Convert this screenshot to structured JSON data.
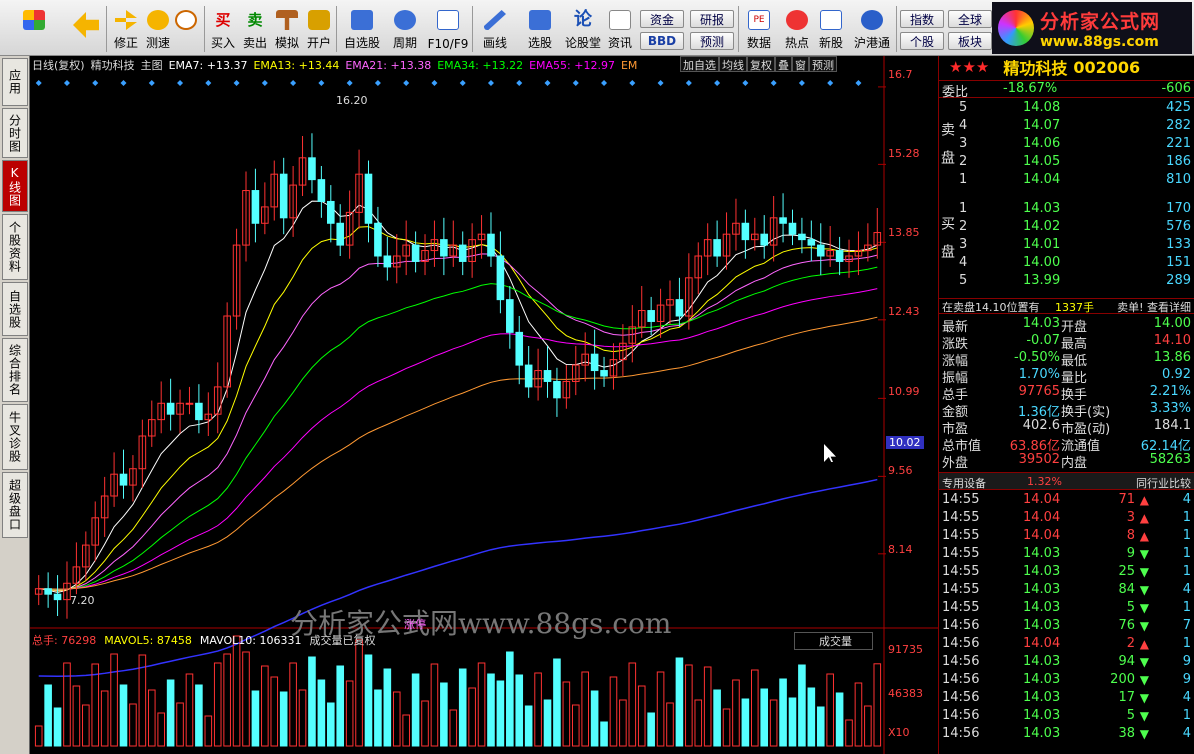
{
  "toolbar": {
    "buttons": [
      {
        "label": "",
        "icon": "app-grid-icon"
      },
      {
        "label": "",
        "icon": "back-arrow-icon"
      },
      {
        "label": "修正",
        "icon": "up-down-icon"
      },
      {
        "label": "测速",
        "icon": "clock-icon"
      },
      {
        "label": "买入",
        "icon": "buy-icon"
      },
      {
        "label": "卖出",
        "icon": "sell-icon"
      },
      {
        "label": "模拟",
        "icon": "hammer-icon"
      },
      {
        "label": "开户",
        "icon": "lock-icon"
      },
      {
        "label": "自选股",
        "icon": "star-icon"
      },
      {
        "label": "周期",
        "icon": "period-icon"
      },
      {
        "label": "F10/F9",
        "icon": "f10-icon"
      },
      {
        "label": "画线",
        "icon": "pen-icon"
      },
      {
        "label": "选股",
        "icon": "select-icon"
      },
      {
        "label": "论股堂",
        "icon": "forum-icon"
      },
      {
        "label": "资讯",
        "icon": "news-icon"
      },
      {
        "label": "数据",
        "icon": "pe-icon"
      },
      {
        "label": "热点",
        "icon": "hot-icon"
      },
      {
        "label": "新股",
        "icon": "newstock-icon"
      },
      {
        "label": "沪港通",
        "icon": "hk-icon"
      }
    ],
    "small_buttons": [
      "资金",
      "BBD",
      "研报",
      "预测",
      "指数",
      "全球",
      "个股",
      "板块"
    ]
  },
  "logo": {
    "title": "分析家公式网",
    "url": "www.88gs.com"
  },
  "side_tabs": [
    "应用",
    "分时图",
    "K线图",
    "个股资料",
    "自选股",
    "综合排名",
    "牛叉诊股",
    "超级盘口"
  ],
  "chart_header": {
    "left": "日线(复权)",
    "stock": "精功科技",
    "main": "主图",
    "ema7": "EMA7: +13.37",
    "ema13": "EMA13: +13.44",
    "ema21": "EMA21: +13.38",
    "ema34": "EMA34: +13.22",
    "ema55": "EMA55: +12.97",
    "em": "EM",
    "right_tabs": [
      "加自选",
      "均线",
      "复权",
      "叠",
      "窗",
      "预测"
    ]
  },
  "colors": {
    "up": "#ff3232",
    "down": "#54ffff",
    "ema7": "#ffffff",
    "ema13": "#ffff00",
    "ema21": "#ff66ff",
    "ema34": "#00ff00",
    "ema55": "#ff00ff",
    "ma_orange": "#ff9933",
    "ma_blue": "#3333ff",
    "ma_lightblue": "#66ccff"
  },
  "chart_data": {
    "type": "candlestick",
    "y_axis": [
      16.7,
      15.28,
      13.85,
      12.43,
      10.99,
      9.56,
      8.14
    ],
    "current_price_tag": "10.02",
    "high_label": "16.20",
    "low_label": "7.20",
    "closes": [
      7.5,
      7.4,
      7.3,
      7.6,
      7.9,
      8.3,
      8.8,
      9.2,
      9.6,
      9.4,
      9.7,
      10.3,
      10.6,
      10.9,
      10.7,
      10.9,
      10.9,
      10.6,
      10.7,
      11.2,
      12.5,
      13.8,
      14.8,
      14.2,
      14.5,
      15.1,
      14.3,
      14.9,
      15.4,
      15.0,
      14.6,
      14.2,
      13.8,
      14.4,
      15.1,
      14.2,
      13.6,
      13.4,
      13.6,
      13.8,
      13.5,
      13.7,
      13.9,
      13.6,
      13.8,
      13.5,
      13.9,
      14.0,
      13.6,
      12.8,
      12.2,
      11.6,
      11.2,
      11.5,
      11.3,
      11.0,
      11.3,
      11.6,
      11.8,
      11.5,
      11.4,
      11.7,
      12.0,
      12.3,
      12.6,
      12.4,
      12.7,
      12.8,
      12.5,
      13.2,
      13.6,
      13.9,
      13.6,
      14.0,
      14.2,
      13.9,
      14.0,
      13.8,
      14.3,
      14.2,
      14.0,
      13.9,
      13.8,
      13.6,
      13.7,
      13.5,
      13.6,
      13.7,
      13.8,
      14.03
    ],
    "volume_label": "总手: 76298",
    "mavol5": "MAVOL5: 87458",
    "mavol10": "MAVOL10: 106331",
    "vol_note": "成交量已复权",
    "vol_axis": [
      "91735",
      "46383",
      "X10"
    ],
    "vol_tab": "成交量",
    "rise_stop": "涨停",
    "watermark": "分析家公式网www.88gs.com"
  },
  "quote": {
    "stars": "★★★",
    "name": "精功科技",
    "code": "002006",
    "weibi_label": "委比",
    "weibi_pct": "-18.67%",
    "weibi_val": "-606",
    "sell_label": "卖盘",
    "buy_label": "买盘",
    "asks": [
      {
        "lv": "5",
        "p": "14.08",
        "v": "425"
      },
      {
        "lv": "4",
        "p": "14.07",
        "v": "282"
      },
      {
        "lv": "3",
        "p": "14.06",
        "v": "221"
      },
      {
        "lv": "2",
        "p": "14.05",
        "v": "186"
      },
      {
        "lv": "1",
        "p": "14.04",
        "v": "810"
      }
    ],
    "bids": [
      {
        "lv": "1",
        "p": "14.03",
        "v": "170"
      },
      {
        "lv": "2",
        "p": "14.02",
        "v": "576"
      },
      {
        "lv": "3",
        "p": "14.01",
        "v": "133"
      },
      {
        "lv": "4",
        "p": "14.00",
        "v": "151"
      },
      {
        "lv": "5",
        "p": "13.99",
        "v": "289"
      }
    ],
    "notice_left": "在卖盘14.10位置有",
    "notice_mid": "1337手",
    "notice_right": "卖单! 查看详细",
    "rows": [
      {
        "k1": "最新",
        "v1": "14.03",
        "k2": "开盘",
        "v2": "14.00"
      },
      {
        "k1": "涨跌",
        "v1": "-0.07",
        "k2": "最高",
        "v2": "14.10"
      },
      {
        "k1": "涨幅",
        "v1": "-0.50%",
        "k2": "最低",
        "v2": "13.86"
      },
      {
        "k1": "振幅",
        "v1": "1.70%",
        "k2": "量比",
        "v2": "0.92"
      },
      {
        "k1": "总手",
        "v1": "97765",
        "k2": "换手",
        "v2": "2.21%"
      },
      {
        "k1": "金额",
        "v1": "1.36亿",
        "k2": "换手(实)",
        "v2": "3.33%"
      },
      {
        "k1": "市盈",
        "v1": "402.6",
        "k2": "市盈(动)",
        "v2": "184.1"
      },
      {
        "k1": "总市值",
        "v1": "63.86亿",
        "k2": "流通值",
        "v2": "62.14亿"
      },
      {
        "k1": "外盘",
        "v1": "39502",
        "k2": "内盘",
        "v2": "58263"
      }
    ],
    "tab_left": "专用设备",
    "tab_pct": "1.32%",
    "tab_right": "同行业比较",
    "ticks": [
      {
        "t": "14:55",
        "p": "14.04",
        "v": "71",
        "d": "up",
        "n": "4"
      },
      {
        "t": "14:55",
        "p": "14.04",
        "v": "3",
        "d": "up",
        "n": "1"
      },
      {
        "t": "14:55",
        "p": "14.04",
        "v": "8",
        "d": "up",
        "n": "1"
      },
      {
        "t": "14:55",
        "p": "14.03",
        "v": "9",
        "d": "down",
        "n": "1"
      },
      {
        "t": "14:55",
        "p": "14.03",
        "v": "25",
        "d": "down",
        "n": "1"
      },
      {
        "t": "14:55",
        "p": "14.03",
        "v": "84",
        "d": "down",
        "n": "4"
      },
      {
        "t": "14:55",
        "p": "14.03",
        "v": "5",
        "d": "down",
        "n": "1"
      },
      {
        "t": "14:56",
        "p": "14.03",
        "v": "76",
        "d": "down",
        "n": "7"
      },
      {
        "t": "14:56",
        "p": "14.04",
        "v": "2",
        "d": "up",
        "n": "1"
      },
      {
        "t": "14:56",
        "p": "14.03",
        "v": "94",
        "d": "down",
        "n": "9"
      },
      {
        "t": "14:56",
        "p": "14.03",
        "v": "200",
        "d": "down",
        "n": "9"
      },
      {
        "t": "14:56",
        "p": "14.03",
        "v": "17",
        "d": "down",
        "n": "4"
      },
      {
        "t": "14:56",
        "p": "14.03",
        "v": "5",
        "d": "down",
        "n": "1"
      },
      {
        "t": "14:56",
        "p": "14.03",
        "v": "38",
        "d": "down",
        "n": "4"
      }
    ]
  }
}
